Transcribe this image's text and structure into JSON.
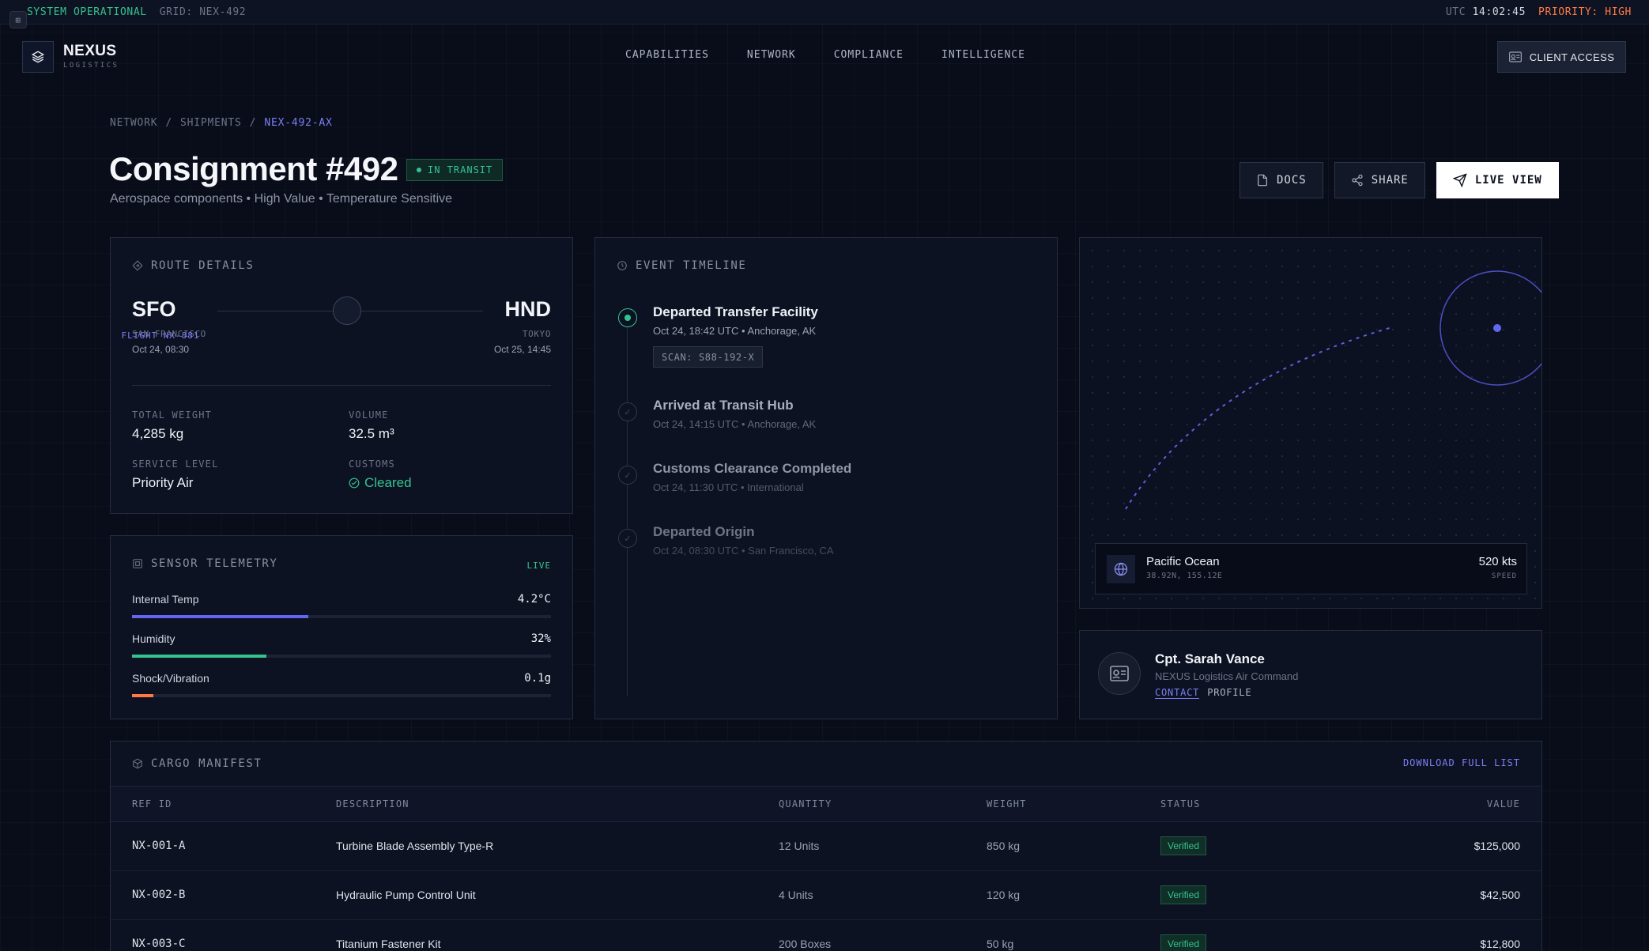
{
  "statusbar": {
    "status": "SYSTEM OPERATIONAL",
    "grid": "GRID: NEX-492",
    "tz": "UTC",
    "time": "14:02:45",
    "priority": "PRIORITY: HIGH"
  },
  "brand": {
    "name": "NEXUS",
    "sub": "LOGISTICS"
  },
  "nav": [
    "CAPABILITIES",
    "NETWORK",
    "COMPLIANCE",
    "INTELLIGENCE"
  ],
  "client_access": "CLIENT ACCESS",
  "breadcrumb": {
    "a": "NETWORK",
    "sep": "/",
    "b": "SHIPMENTS",
    "current": "NEX-492-AX"
  },
  "title": "Consignment #492",
  "status_badge": "IN TRANSIT",
  "subtitle": "Aerospace components • High Value • Temperature Sensitive",
  "actions": {
    "docs": "DOCS",
    "share": "SHARE",
    "live": "LIVE VIEW"
  },
  "route": {
    "heading": "ROUTE DETAILS",
    "origin": {
      "code": "SFO",
      "city": "SAN FRANCISCO",
      "time": "Oct 24, 08:30"
    },
    "dest": {
      "code": "HND",
      "city": "TOKYO",
      "time": "Oct 25, 14:45"
    },
    "flight": "FLIGHT NX-881",
    "weight_label": "TOTAL WEIGHT",
    "weight": "4,285 kg",
    "volume_label": "VOLUME",
    "volume": "32.5 m³",
    "service_label": "SERVICE LEVEL",
    "service": "Priority Air",
    "customs_label": "CUSTOMS",
    "customs": "Cleared"
  },
  "telemetry": {
    "heading": "SENSOR TELEMETRY",
    "live": "LIVE",
    "rows": [
      {
        "label": "Internal Temp",
        "value": "4.2°C",
        "level": 0.42,
        "color": "#6366f1"
      },
      {
        "label": "Humidity",
        "value": "32%",
        "level": 0.32,
        "color": "#34c38f"
      },
      {
        "label": "Shock/Vibration",
        "value": "0.1g",
        "level": 0.05,
        "color": "#ff7a45"
      }
    ]
  },
  "timeline": {
    "heading": "EVENT TIMELINE",
    "events": [
      {
        "title": "Departed Transfer Facility",
        "meta": "Oct 24, 18:42 UTC • Anchorage, AK",
        "scan": "SCAN: S88-192-X"
      },
      {
        "title": "Arrived at Transit Hub",
        "meta": "Oct 24, 14:15 UTC • Anchorage, AK"
      },
      {
        "title": "Customs Clearance Completed",
        "meta": "Oct 24, 11:30 UTC • International"
      },
      {
        "title": "Departed Origin",
        "meta": "Oct 24, 08:30 UTC • San Francisco, CA"
      }
    ]
  },
  "map": {
    "location": "Pacific Ocean",
    "coords": "38.92N, 155.12E",
    "speed": "520 kts",
    "speed_label": "SPEED"
  },
  "contact": {
    "name": "Cpt. Sarah Vance",
    "org": "NEXUS Logistics Air Command",
    "contact": "CONTACT",
    "profile": "PROFILE"
  },
  "manifest": {
    "heading": "CARGO MANIFEST",
    "download": "DOWNLOAD FULL LIST",
    "columns": [
      "REF ID",
      "DESCRIPTION",
      "QUANTITY",
      "WEIGHT",
      "STATUS",
      "VALUE"
    ],
    "rows": [
      {
        "ref": "NX-001-A",
        "desc": "Turbine Blade Assembly Type-R",
        "qty": "12 Units",
        "weight": "850 kg",
        "status": "Verified",
        "value": "$125,000"
      },
      {
        "ref": "NX-002-B",
        "desc": "Hydraulic Pump Control Unit",
        "qty": "4 Units",
        "weight": "120 kg",
        "status": "Verified",
        "value": "$42,500"
      },
      {
        "ref": "NX-003-C",
        "desc": "Titanium Fastener Kit",
        "qty": "200 Boxes",
        "weight": "50 kg",
        "status": "Verified",
        "value": "$12,800"
      }
    ]
  },
  "colors": {
    "accent": "#7b7ff5",
    "success": "#34c38f",
    "warning": "#ff7a45",
    "background": "#090d1a"
  }
}
